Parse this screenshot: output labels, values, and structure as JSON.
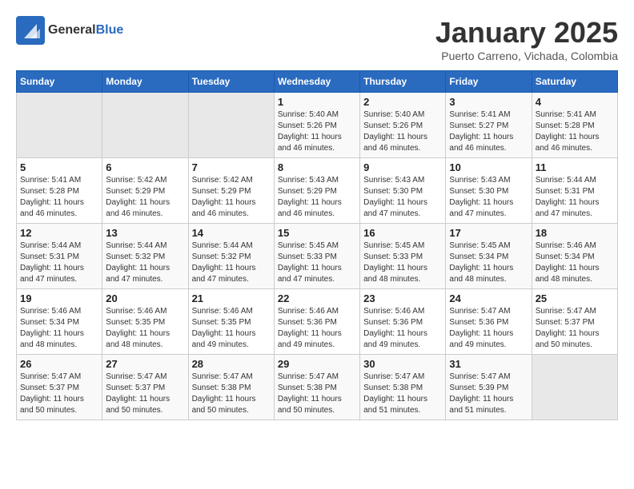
{
  "header": {
    "logo_general": "General",
    "logo_blue": "Blue",
    "month": "January 2025",
    "location": "Puerto Carreno, Vichada, Colombia"
  },
  "weekdays": [
    "Sunday",
    "Monday",
    "Tuesday",
    "Wednesday",
    "Thursday",
    "Friday",
    "Saturday"
  ],
  "weeks": [
    [
      {
        "day": "",
        "sunrise": "",
        "sunset": "",
        "daylight": ""
      },
      {
        "day": "",
        "sunrise": "",
        "sunset": "",
        "daylight": ""
      },
      {
        "day": "",
        "sunrise": "",
        "sunset": "",
        "daylight": ""
      },
      {
        "day": "1",
        "sunrise": "Sunrise: 5:40 AM",
        "sunset": "Sunset: 5:26 PM",
        "daylight": "Daylight: 11 hours and 46 minutes."
      },
      {
        "day": "2",
        "sunrise": "Sunrise: 5:40 AM",
        "sunset": "Sunset: 5:26 PM",
        "daylight": "Daylight: 11 hours and 46 minutes."
      },
      {
        "day": "3",
        "sunrise": "Sunrise: 5:41 AM",
        "sunset": "Sunset: 5:27 PM",
        "daylight": "Daylight: 11 hours and 46 minutes."
      },
      {
        "day": "4",
        "sunrise": "Sunrise: 5:41 AM",
        "sunset": "Sunset: 5:28 PM",
        "daylight": "Daylight: 11 hours and 46 minutes."
      }
    ],
    [
      {
        "day": "5",
        "sunrise": "Sunrise: 5:41 AM",
        "sunset": "Sunset: 5:28 PM",
        "daylight": "Daylight: 11 hours and 46 minutes."
      },
      {
        "day": "6",
        "sunrise": "Sunrise: 5:42 AM",
        "sunset": "Sunset: 5:29 PM",
        "daylight": "Daylight: 11 hours and 46 minutes."
      },
      {
        "day": "7",
        "sunrise": "Sunrise: 5:42 AM",
        "sunset": "Sunset: 5:29 PM",
        "daylight": "Daylight: 11 hours and 46 minutes."
      },
      {
        "day": "8",
        "sunrise": "Sunrise: 5:43 AM",
        "sunset": "Sunset: 5:29 PM",
        "daylight": "Daylight: 11 hours and 46 minutes."
      },
      {
        "day": "9",
        "sunrise": "Sunrise: 5:43 AM",
        "sunset": "Sunset: 5:30 PM",
        "daylight": "Daylight: 11 hours and 47 minutes."
      },
      {
        "day": "10",
        "sunrise": "Sunrise: 5:43 AM",
        "sunset": "Sunset: 5:30 PM",
        "daylight": "Daylight: 11 hours and 47 minutes."
      },
      {
        "day": "11",
        "sunrise": "Sunrise: 5:44 AM",
        "sunset": "Sunset: 5:31 PM",
        "daylight": "Daylight: 11 hours and 47 minutes."
      }
    ],
    [
      {
        "day": "12",
        "sunrise": "Sunrise: 5:44 AM",
        "sunset": "Sunset: 5:31 PM",
        "daylight": "Daylight: 11 hours and 47 minutes."
      },
      {
        "day": "13",
        "sunrise": "Sunrise: 5:44 AM",
        "sunset": "Sunset: 5:32 PM",
        "daylight": "Daylight: 11 hours and 47 minutes."
      },
      {
        "day": "14",
        "sunrise": "Sunrise: 5:44 AM",
        "sunset": "Sunset: 5:32 PM",
        "daylight": "Daylight: 11 hours and 47 minutes."
      },
      {
        "day": "15",
        "sunrise": "Sunrise: 5:45 AM",
        "sunset": "Sunset: 5:33 PM",
        "daylight": "Daylight: 11 hours and 47 minutes."
      },
      {
        "day": "16",
        "sunrise": "Sunrise: 5:45 AM",
        "sunset": "Sunset: 5:33 PM",
        "daylight": "Daylight: 11 hours and 48 minutes."
      },
      {
        "day": "17",
        "sunrise": "Sunrise: 5:45 AM",
        "sunset": "Sunset: 5:34 PM",
        "daylight": "Daylight: 11 hours and 48 minutes."
      },
      {
        "day": "18",
        "sunrise": "Sunrise: 5:46 AM",
        "sunset": "Sunset: 5:34 PM",
        "daylight": "Daylight: 11 hours and 48 minutes."
      }
    ],
    [
      {
        "day": "19",
        "sunrise": "Sunrise: 5:46 AM",
        "sunset": "Sunset: 5:34 PM",
        "daylight": "Daylight: 11 hours and 48 minutes."
      },
      {
        "day": "20",
        "sunrise": "Sunrise: 5:46 AM",
        "sunset": "Sunset: 5:35 PM",
        "daylight": "Daylight: 11 hours and 48 minutes."
      },
      {
        "day": "21",
        "sunrise": "Sunrise: 5:46 AM",
        "sunset": "Sunset: 5:35 PM",
        "daylight": "Daylight: 11 hours and 49 minutes."
      },
      {
        "day": "22",
        "sunrise": "Sunrise: 5:46 AM",
        "sunset": "Sunset: 5:36 PM",
        "daylight": "Daylight: 11 hours and 49 minutes."
      },
      {
        "day": "23",
        "sunrise": "Sunrise: 5:46 AM",
        "sunset": "Sunset: 5:36 PM",
        "daylight": "Daylight: 11 hours and 49 minutes."
      },
      {
        "day": "24",
        "sunrise": "Sunrise: 5:47 AM",
        "sunset": "Sunset: 5:36 PM",
        "daylight": "Daylight: 11 hours and 49 minutes."
      },
      {
        "day": "25",
        "sunrise": "Sunrise: 5:47 AM",
        "sunset": "Sunset: 5:37 PM",
        "daylight": "Daylight: 11 hours and 50 minutes."
      }
    ],
    [
      {
        "day": "26",
        "sunrise": "Sunrise: 5:47 AM",
        "sunset": "Sunset: 5:37 PM",
        "daylight": "Daylight: 11 hours and 50 minutes."
      },
      {
        "day": "27",
        "sunrise": "Sunrise: 5:47 AM",
        "sunset": "Sunset: 5:37 PM",
        "daylight": "Daylight: 11 hours and 50 minutes."
      },
      {
        "day": "28",
        "sunrise": "Sunrise: 5:47 AM",
        "sunset": "Sunset: 5:38 PM",
        "daylight": "Daylight: 11 hours and 50 minutes."
      },
      {
        "day": "29",
        "sunrise": "Sunrise: 5:47 AM",
        "sunset": "Sunset: 5:38 PM",
        "daylight": "Daylight: 11 hours and 50 minutes."
      },
      {
        "day": "30",
        "sunrise": "Sunrise: 5:47 AM",
        "sunset": "Sunset: 5:38 PM",
        "daylight": "Daylight: 11 hours and 51 minutes."
      },
      {
        "day": "31",
        "sunrise": "Sunrise: 5:47 AM",
        "sunset": "Sunset: 5:39 PM",
        "daylight": "Daylight: 11 hours and 51 minutes."
      },
      {
        "day": "",
        "sunrise": "",
        "sunset": "",
        "daylight": ""
      }
    ]
  ]
}
